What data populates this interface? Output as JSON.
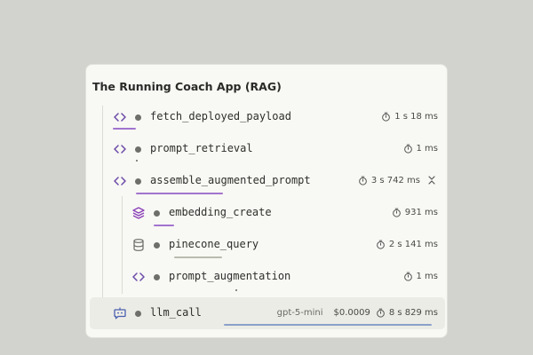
{
  "card": {
    "title": "The Running Coach App (RAG)"
  },
  "spans": [
    {
      "name": "fetch_deployed_payload",
      "duration": "1 s 18 ms",
      "type": "code"
    },
    {
      "name": "prompt_retrieval",
      "duration": "1 ms",
      "type": "code"
    },
    {
      "name": "assemble_augmented_prompt",
      "duration": "3 s 742 ms",
      "type": "code",
      "expanded": true
    },
    {
      "name": "embedding_create",
      "duration": "931 ms",
      "type": "embedding"
    },
    {
      "name": "pinecone_query",
      "duration": "2 s 141 ms",
      "type": "database"
    },
    {
      "name": "prompt_augmentation",
      "duration": "1 ms",
      "type": "code"
    },
    {
      "name": "llm_call",
      "duration": "8 s 829 ms",
      "type": "llm",
      "model": "gpt-5-mini",
      "cost": "$0.0009",
      "selected": true
    }
  ],
  "colors": {
    "code_icon": "#6b4aa8",
    "embedding_icon": "#8a3fb8",
    "database_icon": "#6a6a66",
    "llm_icon": "#4a5fb0",
    "bar_purple": "#a274cf",
    "bar_gray": "#b9bbb0",
    "bar_blue": "#8aa0c8"
  },
  "icons": {
    "code": "code-brackets-icon",
    "embedding": "layers-icon",
    "database": "database-icon",
    "llm": "bot-chat-icon",
    "timer": "stopwatch-icon",
    "collapse": "chevrons-collapse-icon"
  }
}
